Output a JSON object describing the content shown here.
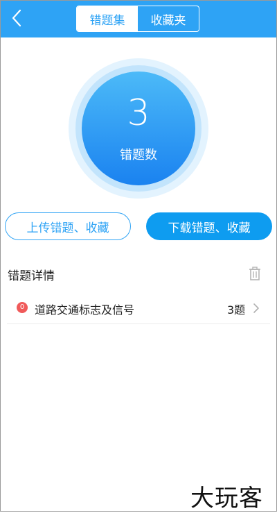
{
  "header": {
    "back_icon": "chevron-left-icon",
    "tabs": [
      {
        "label": "错题集",
        "active": true
      },
      {
        "label": "收藏夹",
        "active": false
      }
    ]
  },
  "counter": {
    "value": "3",
    "label": "错题数"
  },
  "actions": {
    "upload_label": "上传错题、收藏",
    "download_label": "下载错题、收藏"
  },
  "details": {
    "title": "错题详情",
    "delete_icon": "trash-icon",
    "items": [
      {
        "badge": "0",
        "label": "道路交通标志及信号",
        "count": "3题"
      }
    ]
  },
  "watermark": "大玩客",
  "colors": {
    "primary": "#2ea3f5",
    "badge": "#f05a5a"
  }
}
